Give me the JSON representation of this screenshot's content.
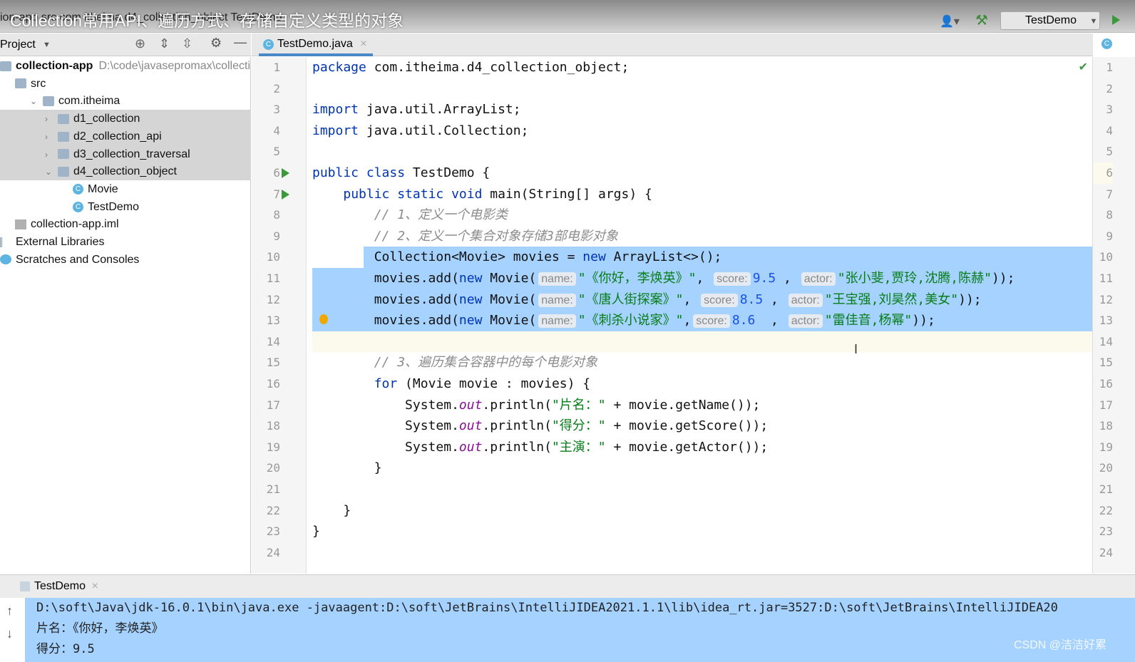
{
  "overlay_title": "Collection常用API、遍历方式、存储自定义类型的对象",
  "breadcrumb": "ion-app  src  com  itheima  d4_collection_object  TestDemo",
  "toolbar": {
    "run_config": "TestDemo"
  },
  "project": {
    "header": "Project",
    "items": [
      {
        "label": "collection-app",
        "extra": "D:\\code\\javasepromax\\collecti",
        "icon": "module",
        "indent": 0,
        "bold": true
      },
      {
        "label": "src",
        "icon": "folder",
        "indent": 1
      },
      {
        "label": "com.itheima",
        "icon": "folder",
        "indent": 2,
        "arrow": "v"
      },
      {
        "label": "d1_collection",
        "icon": "folder",
        "indent": 3,
        "arrow": ">",
        "selected": true
      },
      {
        "label": "d2_collection_api",
        "icon": "folder",
        "indent": 3,
        "arrow": ">",
        "selected": true
      },
      {
        "label": "d3_collection_traversal",
        "icon": "folder",
        "indent": 3,
        "arrow": ">",
        "selected": true
      },
      {
        "label": "d4_collection_object",
        "icon": "folder",
        "indent": 3,
        "arrow": "v",
        "selected": true
      },
      {
        "label": "Movie",
        "icon": "class",
        "indent": 4
      },
      {
        "label": "TestDemo",
        "icon": "class",
        "indent": 4
      },
      {
        "label": "collection-app.iml",
        "icon": "file",
        "indent": 1
      },
      {
        "label": "External Libraries",
        "icon": "lib",
        "indent": 0
      },
      {
        "label": "Scratches and Consoles",
        "icon": "scratch",
        "indent": 0
      }
    ]
  },
  "editor": {
    "tab": "TestDemo.java",
    "lines": [
      [
        [
          "package",
          "kw"
        ],
        [
          " com.itheima.d4_collection_object;",
          ""
        ]
      ],
      [],
      [
        [
          "import",
          "kw"
        ],
        [
          " java.util.ArrayList;",
          ""
        ]
      ],
      [
        [
          "import",
          "kw"
        ],
        [
          " java.util.Collection;",
          ""
        ]
      ],
      [],
      [
        [
          "public class",
          "kw"
        ],
        [
          " TestDemo {",
          ""
        ]
      ],
      [
        [
          "    "
        ],
        [
          "public static void",
          "kw"
        ],
        [
          " main(String[] args) {",
          ""
        ]
      ],
      [
        [
          "        "
        ],
        [
          "// 1、定义一个电影类",
          "cm"
        ]
      ],
      [
        [
          "        "
        ],
        [
          "// 2、定义一个集合对象存储3部电影对象",
          "cm"
        ]
      ],
      [
        [
          "        Collection<Movie> movies = ",
          ""
        ],
        [
          "new",
          "kw"
        ],
        [
          " ArrayList<>();",
          ""
        ]
      ],
      [
        [
          "        movies.add(",
          ""
        ],
        [
          "new",
          "kw"
        ],
        [
          " Movie(",
          ""
        ],
        [
          "name:",
          "hint"
        ],
        [
          "\"《你好，李焕英》\"",
          "st"
        ],
        [
          ", ",
          ""
        ],
        [
          "score:",
          "hint"
        ],
        [
          "9.5",
          "nm"
        ],
        [
          " , ",
          ""
        ],
        [
          "actor:",
          "hint"
        ],
        [
          "\"张小斐,贾玲,沈腾,陈赫\"",
          "st"
        ],
        [
          "));",
          ""
        ]
      ],
      [
        [
          "        movies.add(",
          ""
        ],
        [
          "new",
          "kw"
        ],
        [
          " Movie(",
          ""
        ],
        [
          "name:",
          "hint"
        ],
        [
          "\"《唐人街探案》\"",
          "st"
        ],
        [
          ", ",
          ""
        ],
        [
          "score:",
          "hint"
        ],
        [
          "8.5",
          "nm"
        ],
        [
          " , ",
          ""
        ],
        [
          "actor:",
          "hint"
        ],
        [
          "\"王宝强,刘昊然,美女\"",
          "st"
        ],
        [
          "));",
          ""
        ]
      ],
      [
        [
          "        movies.add(",
          ""
        ],
        [
          "new",
          "kw"
        ],
        [
          " Movie(",
          ""
        ],
        [
          "name:",
          "hint"
        ],
        [
          "\"《刺杀小说家》\"",
          "st"
        ],
        [
          ",",
          ""
        ],
        [
          "score:",
          "hint"
        ],
        [
          "8.6",
          "nm"
        ],
        [
          "  , ",
          ""
        ],
        [
          "actor:",
          "hint"
        ],
        [
          "\"雷佳音,杨幂\"",
          "st"
        ],
        [
          "));",
          ""
        ]
      ],
      [],
      [
        [
          "        "
        ],
        [
          "// 3、遍历集合容器中的每个电影对象",
          "cm"
        ]
      ],
      [
        [
          "        "
        ],
        [
          "for",
          "kw"
        ],
        [
          " (Movie movie : movies) {",
          ""
        ]
      ],
      [
        [
          "            System.",
          ""
        ],
        [
          "out",
          "fi"
        ],
        [
          ".println(",
          ""
        ],
        [
          "\"片名：\"",
          "st"
        ],
        [
          " + movie.getName());",
          ""
        ]
      ],
      [
        [
          "            System.",
          ""
        ],
        [
          "out",
          "fi"
        ],
        [
          ".println(",
          ""
        ],
        [
          "\"得分：\"",
          "st"
        ],
        [
          " + movie.getScore());",
          ""
        ]
      ],
      [
        [
          "            System.",
          ""
        ],
        [
          "out",
          "fi"
        ],
        [
          ".println(",
          ""
        ],
        [
          "\"主演：\"",
          "st"
        ],
        [
          " + movie.getActor());",
          ""
        ]
      ],
      [
        [
          "        }",
          ""
        ]
      ],
      [],
      [
        [
          "    }",
          ""
        ]
      ],
      [
        [
          "}",
          ""
        ]
      ],
      []
    ]
  },
  "console": {
    "tab": "TestDemo",
    "lines": [
      "D:\\soft\\Java\\jdk-16.0.1\\bin\\java.exe -javaagent:D:\\soft\\JetBrains\\IntelliJIDEA2021.1.1\\lib\\idea_rt.jar=3527:D:\\soft\\JetBrains\\IntelliJIDEA20",
      "片名：《你好，李焕英》",
      "得分：9.5"
    ]
  },
  "watermark": "CSDN @洁洁好累",
  "colors": {
    "selection": "#a6d2ff",
    "keyword": "#0033b3",
    "string": "#067d17",
    "number": "#1750eb",
    "accent": "#4a88c7"
  }
}
